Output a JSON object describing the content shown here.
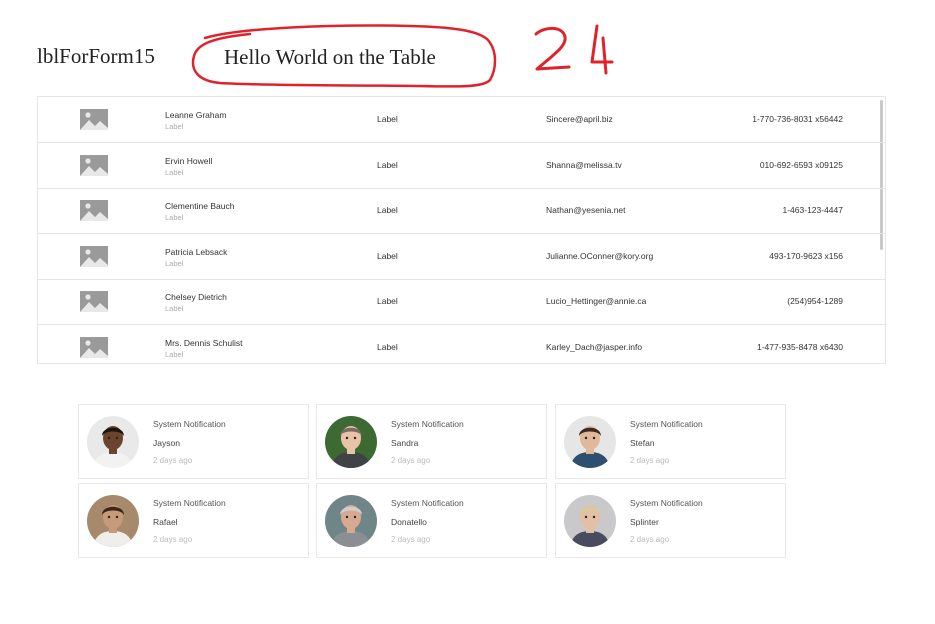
{
  "header": {
    "form_label": "lblForForm15",
    "title": "Hello World on the Table",
    "annotation_number": "24",
    "annotation_color": "#e0232a"
  },
  "table": {
    "rows": [
      {
        "name": "Leanne Graham",
        "sub": "Label",
        "label": "Label",
        "email": "Sincere@april.biz",
        "phone": "1-770-736-8031 x56442"
      },
      {
        "name": "Ervin Howell",
        "sub": "Label",
        "label": "Label",
        "email": "Shanna@melissa.tv",
        "phone": "010-692-6593 x09125"
      },
      {
        "name": "Clementine Bauch",
        "sub": "Label",
        "label": "Label",
        "email": "Nathan@yesenia.net",
        "phone": "1-463-123-4447"
      },
      {
        "name": "Patricia Lebsack",
        "sub": "Label",
        "label": "Label",
        "email": "Julianne.OConner@kory.org",
        "phone": "493-170-9623 x156"
      },
      {
        "name": "Chelsey Dietrich",
        "sub": "Label",
        "label": "Label",
        "email": "Lucio_Hettinger@annie.ca",
        "phone": "(254)954-1289"
      },
      {
        "name": "Mrs. Dennis Schulist",
        "sub": "Label",
        "label": "Label",
        "email": "Karley_Dach@jasper.info",
        "phone": "1-477-935-8478 x6430"
      }
    ]
  },
  "cards": [
    {
      "title": "System Notification",
      "name": "Jayson",
      "time": "2 days ago",
      "skin": "#6b4430",
      "hair": "#1c1410",
      "bg": "#e9e9e9",
      "shirt": "#f2f2f2"
    },
    {
      "title": "System Notification",
      "name": "Sandra",
      "time": "2 days ago",
      "skin": "#e8c3a8",
      "hair": "#7a6a68",
      "bg": "#3d6a33",
      "shirt": "#3f4348"
    },
    {
      "title": "System Notification",
      "name": "Stefan",
      "time": "2 days ago",
      "skin": "#e2b89a",
      "hair": "#3a2a20",
      "bg": "#e6e6e6",
      "shirt": "#2f4f6e"
    },
    {
      "title": "System Notification",
      "name": "Rafael",
      "time": "2 days ago",
      "skin": "#c79a7a",
      "hair": "#3b2619",
      "bg": "#a7896b",
      "shirt": "#f0eeea"
    },
    {
      "title": "System Notification",
      "name": "Donatello",
      "time": "2 days ago",
      "skin": "#d7aa90",
      "hair": "#cfcfcf",
      "bg": "#6f8588",
      "shirt": "#8a8f94"
    },
    {
      "title": "System Notification",
      "name": "Splinter",
      "time": "2 days ago",
      "skin": "#e3c0a5",
      "hair": "#d9c9a0",
      "bg": "#c9c9cc",
      "shirt": "#484c5e"
    }
  ]
}
